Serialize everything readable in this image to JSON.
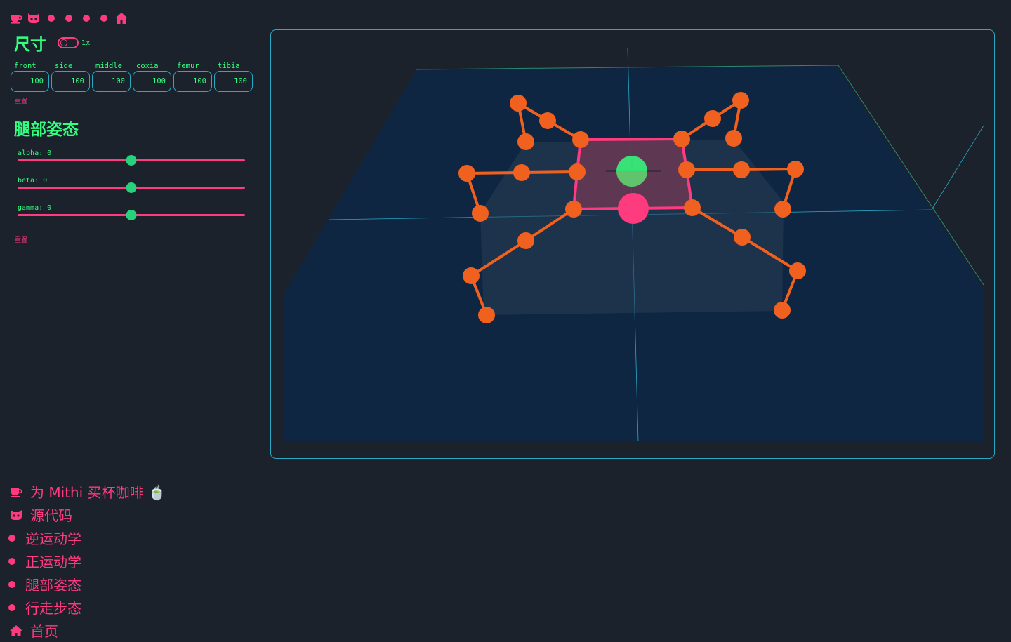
{
  "topnav": {
    "icons": [
      "coffee-icon",
      "github-icon",
      "dot",
      "dot",
      "dot",
      "dot",
      "home-icon"
    ]
  },
  "dimensions": {
    "title": "尺寸",
    "toggle_label": "1x",
    "fields": [
      {
        "label": "front",
        "value": "100"
      },
      {
        "label": "side",
        "value": "100"
      },
      {
        "label": "middle",
        "value": "100"
      },
      {
        "label": "coxia",
        "value": "100"
      },
      {
        "label": "femur",
        "value": "100"
      },
      {
        "label": "tibia",
        "value": "100"
      }
    ],
    "reset_label": "重置"
  },
  "leg_pose": {
    "title": "腿部姿态",
    "sliders": [
      {
        "label": "alpha: 0",
        "value": 0,
        "fraction": 0.5
      },
      {
        "label": "beta: 0",
        "value": 0,
        "fraction": 0.5
      },
      {
        "label": "gamma: 0",
        "value": 0,
        "fraction": 0.5
      }
    ],
    "reset_label": "重置"
  },
  "bottom_nav": {
    "items": [
      {
        "label": "为 Mithi 买杯咖啡 🍵",
        "icon": "coffee-icon"
      },
      {
        "label": "源代码",
        "icon": "github-icon"
      },
      {
        "label": "逆运动学",
        "icon": "dot"
      },
      {
        "label": "正运动学",
        "icon": "dot"
      },
      {
        "label": "腿部姿态",
        "icon": "dot"
      },
      {
        "label": "行走步态",
        "icon": "dot"
      },
      {
        "label": "首页",
        "icon": "home-icon"
      }
    ]
  },
  "colors": {
    "accent_pink": "#ff3b7f",
    "accent_green": "#32ff7e",
    "leg_orange": "#f0611f",
    "plane_blue": "#0f2642",
    "background": "#1b222c",
    "frame_border": "#2aa8c4"
  }
}
